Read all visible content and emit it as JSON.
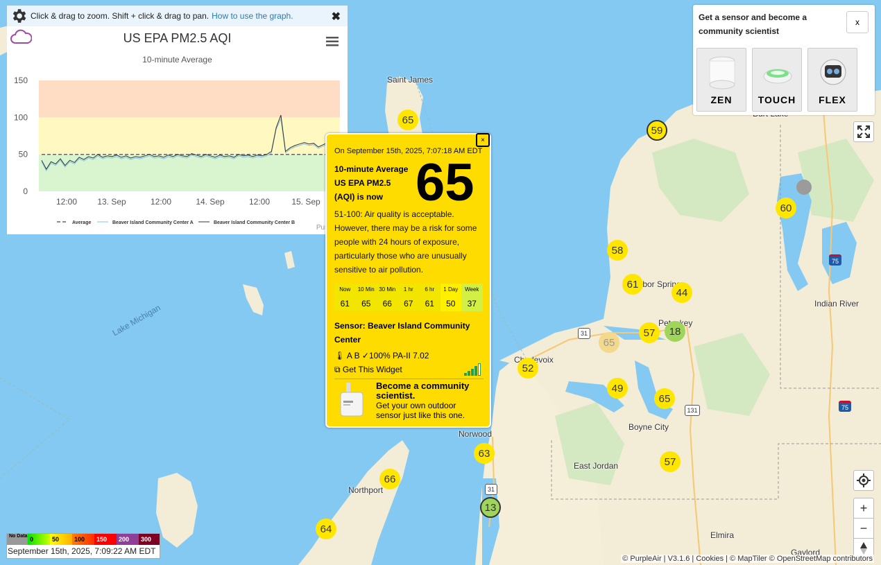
{
  "chart_panel": {
    "instructions": "Click & drag to zoom. Shift + click & drag to pan.",
    "link": "How to use the graph.",
    "close": "✖",
    "title": "US EPA PM2.5 AQI",
    "subtitle": "10-minute Average",
    "credit": "PurpleAir"
  },
  "chart_data": {
    "type": "line",
    "title": "US EPA PM2.5 AQI",
    "subtitle": "10-minute Average",
    "ylim": [
      0,
      150
    ],
    "yticks": [
      0,
      50,
      100,
      150
    ],
    "xticks": [
      "12:00",
      "13. Sep",
      "12:00",
      "14. Sep",
      "12:00",
      "15. Sep"
    ],
    "bands": [
      {
        "from": 0,
        "to": 50,
        "color": "#d9f5d0"
      },
      {
        "from": 50,
        "to": 100,
        "color": "#fff8c0"
      },
      {
        "from": 100,
        "to": 150,
        "color": "#ffdcc4"
      }
    ],
    "legend": [
      "Average",
      "Beaver Island Community Center A",
      "Beaver Island Community Center B"
    ],
    "series": [
      {
        "name": "Average",
        "values": [
          50,
          50,
          50,
          50,
          50,
          50,
          50,
          50,
          50,
          50,
          50,
          50,
          50,
          50,
          50,
          50,
          50,
          50,
          50,
          50,
          50,
          50,
          50,
          50,
          50,
          50,
          50,
          50,
          50,
          50,
          50,
          50,
          50,
          50,
          50,
          50,
          50,
          50,
          50,
          50,
          50,
          50,
          50,
          50,
          50,
          50,
          50,
          50,
          50,
          50,
          50,
          50,
          50,
          50,
          50,
          50,
          50,
          50,
          50,
          50,
          50,
          50,
          50,
          50
        ]
      },
      {
        "name": "Beaver Island Community Center A",
        "values": [
          40,
          28,
          38,
          35,
          42,
          33,
          40,
          37,
          44,
          41,
          45,
          43,
          48,
          44,
          46,
          45,
          47,
          44,
          46,
          43,
          45,
          44,
          46,
          48,
          45,
          46,
          44,
          47,
          45,
          48,
          46,
          45,
          49,
          47,
          45,
          48,
          46,
          44,
          47,
          45,
          46,
          44,
          48,
          46,
          47,
          45,
          47,
          46,
          48,
          52,
          84,
          98,
          52,
          57,
          60,
          62,
          64,
          62,
          63,
          58,
          61,
          64,
          68,
          70
        ]
      },
      {
        "name": "Beaver Island Community Center B",
        "values": [
          42,
          30,
          40,
          37,
          44,
          35,
          42,
          39,
          46,
          43,
          47,
          45,
          50,
          46,
          48,
          47,
          49,
          46,
          48,
          45,
          47,
          46,
          48,
          50,
          47,
          48,
          46,
          49,
          47,
          50,
          48,
          47,
          51,
          49,
          47,
          50,
          48,
          46,
          49,
          47,
          48,
          46,
          50,
          48,
          49,
          47,
          49,
          48,
          50,
          54,
          86,
          103,
          54,
          59,
          62,
          64,
          66,
          64,
          65,
          60,
          63,
          66,
          70,
          72
        ]
      }
    ]
  },
  "popup": {
    "close": "×",
    "date": "On September 15th, 2025, 7:07:18 AM EDT",
    "label": "10-minute Average US EPA PM2.5 (AQI) is now",
    "value": "65",
    "description": "51-100: Air quality is acceptable. However, there may be a risk for some people with 24 hours of exposure, particularly those who are unusually sensitive to air pollution.",
    "stats": [
      {
        "label": "Now",
        "value": "61"
      },
      {
        "label": "10 Min",
        "value": "65"
      },
      {
        "label": "30 Min",
        "value": "66"
      },
      {
        "label": "1 hr",
        "value": "67"
      },
      {
        "label": "6 hr",
        "value": "61"
      },
      {
        "label": "1 Day",
        "value": "50"
      },
      {
        "label": "Week",
        "value": "37"
      }
    ],
    "sensor": "Sensor: Beaver Island Community Center",
    "meta": "🌡 A B ✓100% PA-II 7.02",
    "widget": "⧉ Get This Widget",
    "cta_title": "Become a community scientist.",
    "cta_text": "Get your own outdoor sensor just like this one."
  },
  "promo": {
    "text": "Get a sensor and become a community scientist",
    "close": "x",
    "cards": [
      "ZEN",
      "TOUCH",
      "FLEX"
    ]
  },
  "map": {
    "labels": [
      {
        "text": "Saint James"
      },
      {
        "text": "Charlevoix"
      },
      {
        "text": "Harbor Springs"
      },
      {
        "text": "Petoskey"
      },
      {
        "text": "Boyne City"
      },
      {
        "text": "East Jordan"
      },
      {
        "text": "Norwood"
      },
      {
        "text": "Northport"
      },
      {
        "text": "Indian River"
      },
      {
        "text": "Elmira"
      },
      {
        "text": "Gaylord"
      },
      {
        "text": "Burt Lake"
      }
    ],
    "water_label": "Lake Michigan",
    "markers": [
      "65",
      "59",
      "60",
      "58",
      "61",
      "44",
      "57",
      "18",
      "65",
      "52",
      "49",
      "65",
      "63",
      "66",
      "13",
      "64",
      "57"
    ],
    "shields": [
      "31",
      "31",
      "131",
      "75",
      "75"
    ]
  },
  "legend": {
    "no_data": "No Data",
    "bins": [
      "0",
      "50",
      "100",
      "150",
      "200",
      "300"
    ],
    "colors": [
      "#00e400",
      "#ffff00",
      "#ff7e00",
      "#ff0000",
      "#8f3f97",
      "#7e0023"
    ],
    "timestamp": "September 15th, 2025, 7:09:22 AM EDT"
  },
  "attribution": "© PurpleAir | V3.1.6 | Cookies | © MapTiler © OpenStreetMap contributors",
  "controls": {
    "fullscreen": "⛶",
    "locate": "◎",
    "zoom_in": "+",
    "zoom_out": "−",
    "compass": "▲"
  }
}
